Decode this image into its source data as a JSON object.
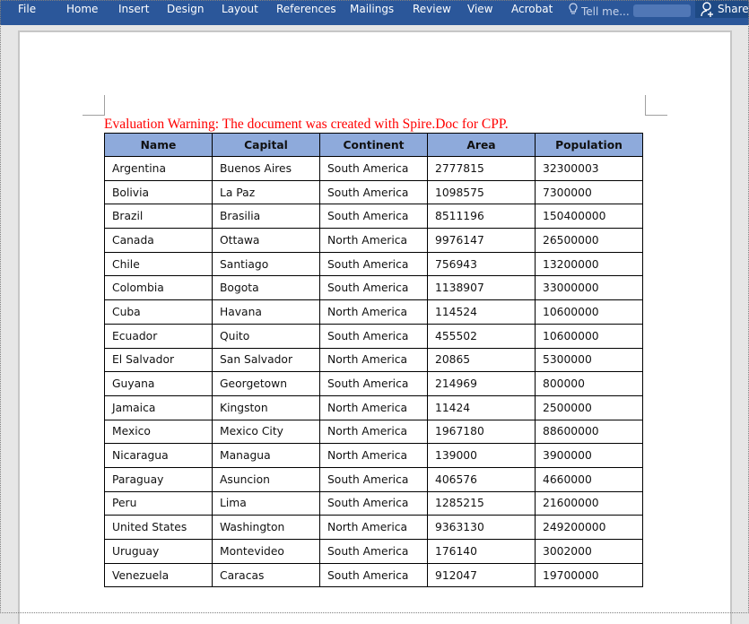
{
  "ribbon": {
    "tabs": [
      "File",
      "Home",
      "Insert",
      "Design",
      "Layout",
      "References",
      "Mailings",
      "Review",
      "View",
      "Acrobat"
    ],
    "tell_me_placeholder": "Tell me...",
    "share_label": "Share",
    "colors": {
      "ribbon_bg": "#2b579a",
      "share_bg": "#1e4a85"
    }
  },
  "document": {
    "warning": "Evaluation Warning: The document was created with Spire.Doc for CPP.",
    "warning_color": "#ff0000",
    "table": {
      "header_color": "#8eaadb",
      "headers": [
        "Name",
        "Capital",
        "Continent",
        "Area",
        "Population"
      ],
      "rows": [
        [
          "Argentina",
          "Buenos Aires",
          "South America",
          "2777815",
          "32300003"
        ],
        [
          "Bolivia",
          "La Paz",
          "South America",
          "1098575",
          "7300000"
        ],
        [
          "Brazil",
          "Brasilia",
          "South America",
          "8511196",
          "150400000"
        ],
        [
          "Canada",
          "Ottawa",
          "North America",
          "9976147",
          "26500000"
        ],
        [
          "Chile",
          "Santiago",
          "South America",
          "756943",
          "13200000"
        ],
        [
          "Colombia",
          "Bogota",
          "South America",
          "1138907",
          "33000000"
        ],
        [
          "Cuba",
          "Havana",
          "North America",
          "114524",
          "10600000"
        ],
        [
          "Ecuador",
          "Quito",
          "South America",
          "455502",
          "10600000"
        ],
        [
          "El Salvador",
          "San Salvador",
          "North America",
          "20865",
          "5300000"
        ],
        [
          "Guyana",
          "Georgetown",
          "South America",
          "214969",
          "800000"
        ],
        [
          "Jamaica",
          "Kingston",
          "North America",
          "11424",
          "2500000"
        ],
        [
          "Mexico",
          "Mexico City",
          "North America",
          "1967180",
          "88600000"
        ],
        [
          "Nicaragua",
          "Managua",
          "North America",
          "139000",
          "3900000"
        ],
        [
          "Paraguay",
          "Asuncion",
          "South America",
          "406576",
          "4660000"
        ],
        [
          "Peru",
          "Lima",
          "South America",
          "1285215",
          "21600000"
        ],
        [
          "United States",
          "Washington",
          "North America",
          "9363130",
          "249200000"
        ],
        [
          "Uruguay",
          "Montevideo",
          "South America",
          "176140",
          "3002000"
        ],
        [
          "Venezuela",
          "Caracas",
          "South America",
          "912047",
          "19700000"
        ]
      ]
    }
  }
}
